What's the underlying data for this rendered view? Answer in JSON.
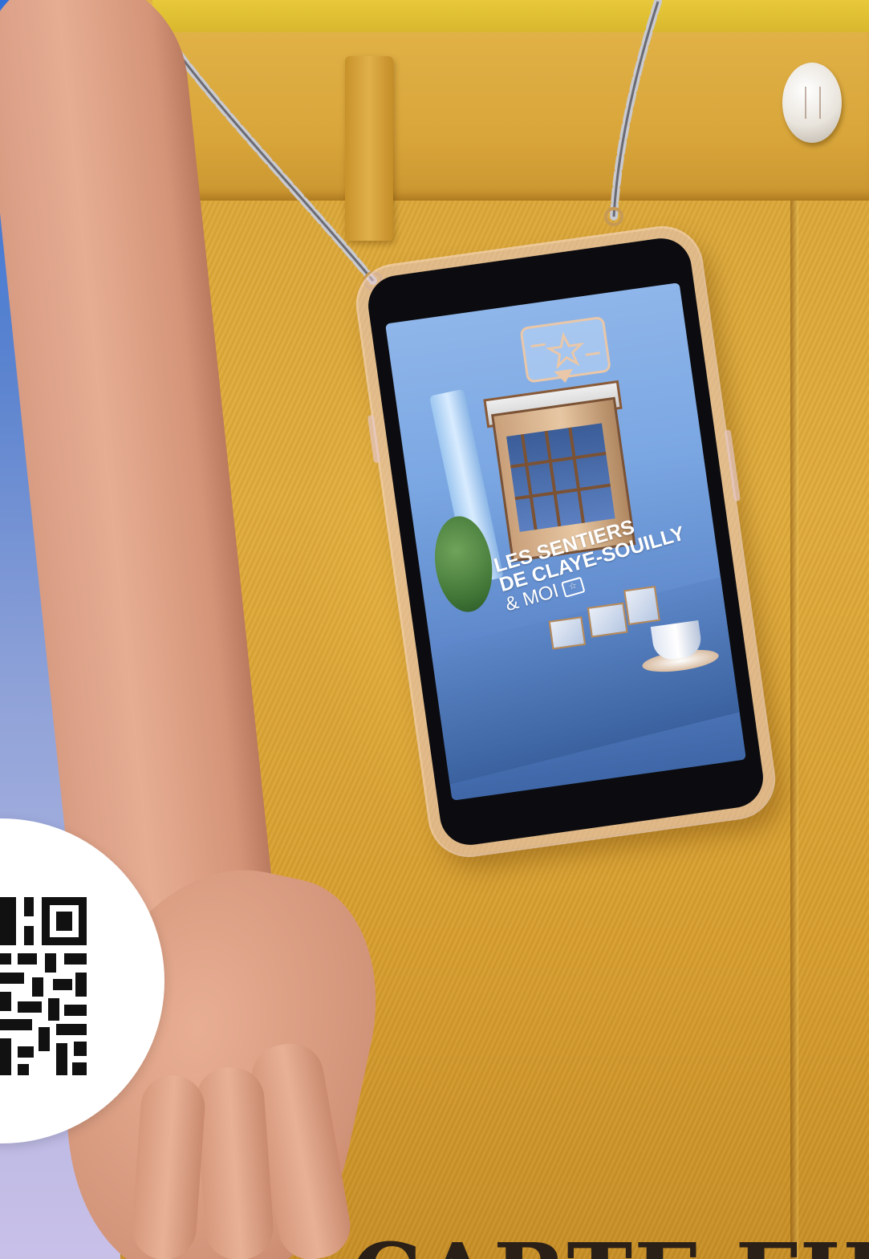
{
  "phone_screen": {
    "title_line1": "LES SENTIERS",
    "title_line2": "DE CLAYE-SOUILLY",
    "title_line3": "& MOI",
    "icon": "loyalty-card-star-icon"
  },
  "headline_partial": "CARTE FIDÉLITÉ",
  "colors": {
    "background_blue": "#2f6fd8",
    "trousers_yellow": "#d9a637",
    "phone_screen_blue": "#7aa6e2",
    "accent_copper": "#c48d5a"
  },
  "qr_code": {
    "name": "qr-code"
  }
}
